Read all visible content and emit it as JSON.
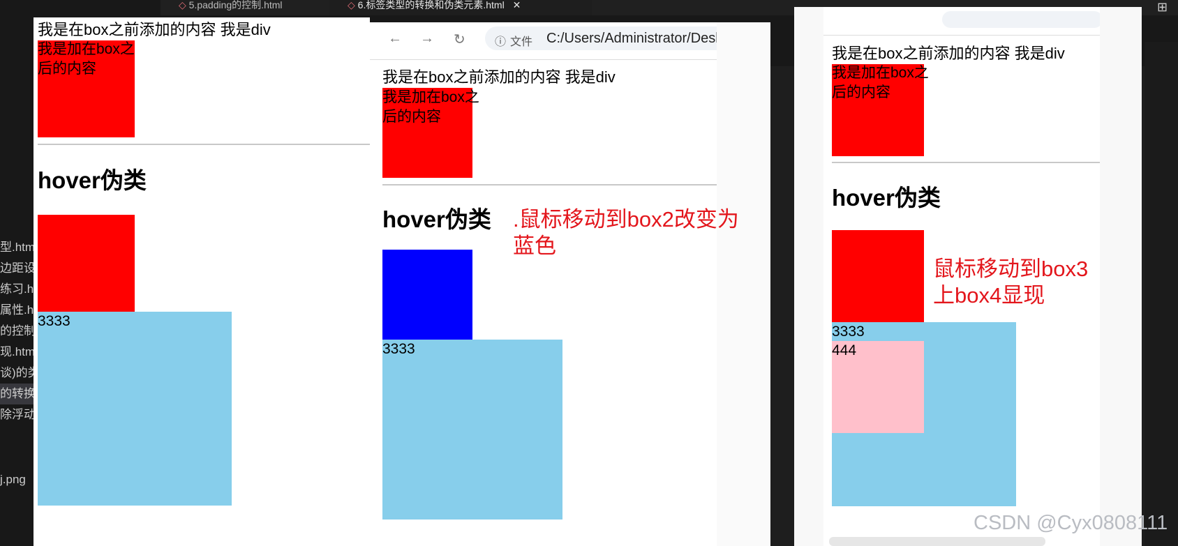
{
  "editor": {
    "tabs": [
      {
        "label": "5.padding的控制.html",
        "active": false
      },
      {
        "label": "6.标签类型的转换和伪类元素.html",
        "active": true
      }
    ],
    "sidebar_files": [
      {
        "label": "型.htm",
        "selected": false
      },
      {
        "label": "边距设",
        "selected": false
      },
      {
        "label": "练习.ht",
        "selected": false
      },
      {
        "label": "属性.h",
        "selected": false
      },
      {
        "label": "的控制",
        "selected": false
      },
      {
        "label": "现.htm",
        "selected": false
      },
      {
        "label": "谈)的类",
        "selected": false
      },
      {
        "label": "的转换",
        "selected": true
      },
      {
        "label": "除浮动",
        "selected": false
      },
      {
        "label": "j.png",
        "selected": false
      }
    ]
  },
  "page": {
    "before_text": "我是在box之前添加的内容 我是div",
    "after_text": "我是加在box之后的内容",
    "heading": "hover伪类",
    "box3_text": "3333",
    "box4_text": "444"
  },
  "browser": {
    "address": "C:/Users/Administrator/Desk",
    "file_label": "文件"
  },
  "annotations": {
    "note1": ".鼠标移动到box2改变为蓝色",
    "note2": "鼠标移动到box3上box4显现"
  },
  "watermark": "CSDN @Cyx0808111",
  "colors": {
    "box": "#ff0000",
    "box2_hover": "#0000ff",
    "box3": "#87ceeb",
    "box4": "#ffc0cb",
    "annotation": "#e3161c"
  }
}
